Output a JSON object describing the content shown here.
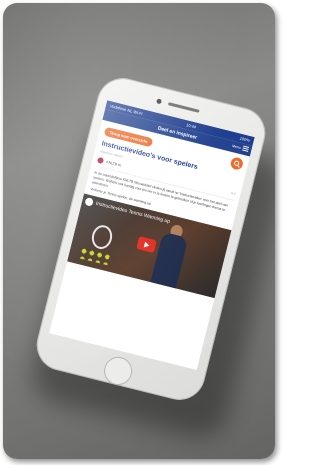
{
  "status_bar": {
    "carrier": "Vodafone NL Wi-Fi",
    "time": "10:44",
    "battery": "100%"
  },
  "app_bar": {
    "title": "Deel en inspireer",
    "menu_label": "Menu"
  },
  "back_button": {
    "label": "Terug naar overzicht"
  },
  "article": {
    "title": "Instructievideo's voor spelers",
    "tag": "Algemene video's",
    "author": "KNLTB KI",
    "likes": "0",
    "paragraph_1": "In de maandelijkse KNLTB Nieuwsbrief vinden jij vanaf nu 'Instructievideo' voor het spel van spelers. Wellicht ook handig voor jou om er je lessen te gebruiken of je leerlingen thema te attenderen.",
    "paragraph_2": "Verbeter je Tennis spelen, de warming-up"
  },
  "video": {
    "title": "Instructievideo Tennis Warming up"
  },
  "colors": {
    "brand_blue": "#22418f",
    "accent_orange": "#ee6a2a",
    "play_red": "#e52a1f"
  },
  "icons": {
    "search": "search-icon",
    "menu": "hamburger-icon",
    "play": "play-icon"
  }
}
